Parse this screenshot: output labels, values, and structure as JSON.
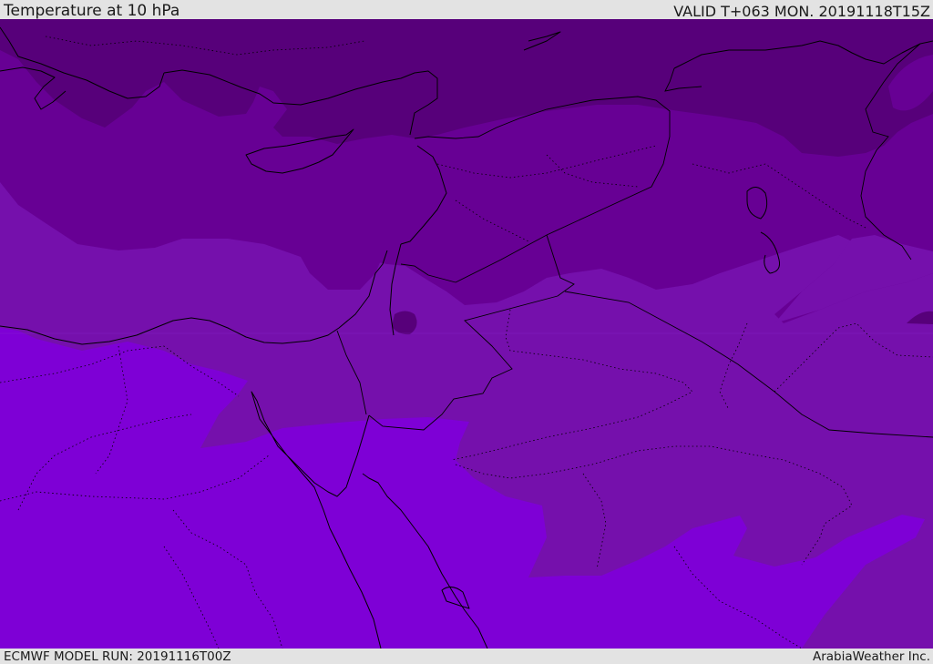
{
  "header": {
    "title": "Temperature at 10 hPa",
    "valid": "VALID T+063 MON. 20191118T15Z"
  },
  "footer": {
    "model_run": "ECMWF MODEL RUN: 20191116T00Z",
    "brand": "ArabiaWeather Inc."
  },
  "map": {
    "variable": "temperature",
    "level": "10 hPa",
    "colors": {
      "darkest": "#57007a",
      "dark": "#670094",
      "medium": "#7510ac",
      "light": "#7e00d6",
      "border": "#000000"
    }
  }
}
